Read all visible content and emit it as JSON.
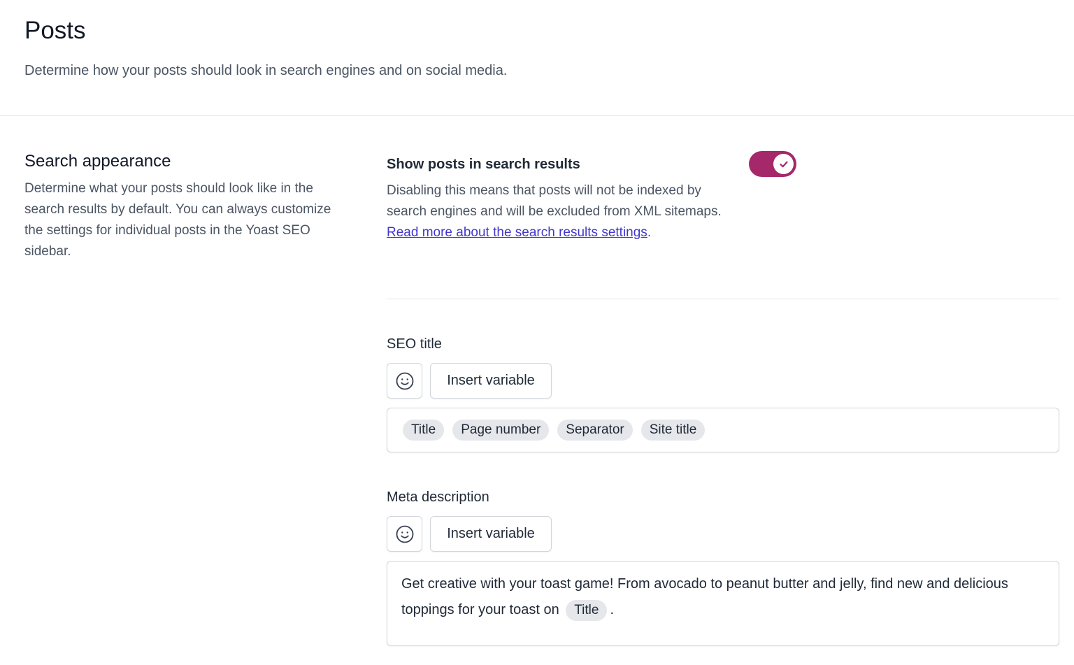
{
  "header": {
    "title": "Posts",
    "subtitle": "Determine how your posts should look in search engines and on social media."
  },
  "section": {
    "title": "Search appearance",
    "description": "Determine what your posts should look like in the search results by default. You can always customize the settings for individual posts in the Yoast SEO sidebar."
  },
  "search_results_toggle": {
    "label": "Show posts in search results",
    "description_prefix": "Disabling this means that posts will not be indexed by search engines and will be excluded from XML sitemaps. ",
    "link_text": "Read more about the search results settings",
    "description_suffix": ".",
    "enabled": true,
    "accent_color": "#a4286a"
  },
  "seo_title": {
    "label": "SEO title",
    "emoji_icon": "smiley-icon",
    "insert_variable_label": "Insert variable",
    "chips": [
      "Title",
      "Page number",
      "Separator",
      "Site title"
    ]
  },
  "meta_description": {
    "label": "Meta description",
    "emoji_icon": "smiley-icon",
    "insert_variable_label": "Insert variable",
    "text_before": "Get creative with your toast game! From avocado to peanut butter and jelly, find new and delicious toppings for your toast on",
    "chip": "Title",
    "text_after": "."
  },
  "colors": {
    "link": "#4338ca",
    "chip_bg": "#e5e7eb"
  }
}
